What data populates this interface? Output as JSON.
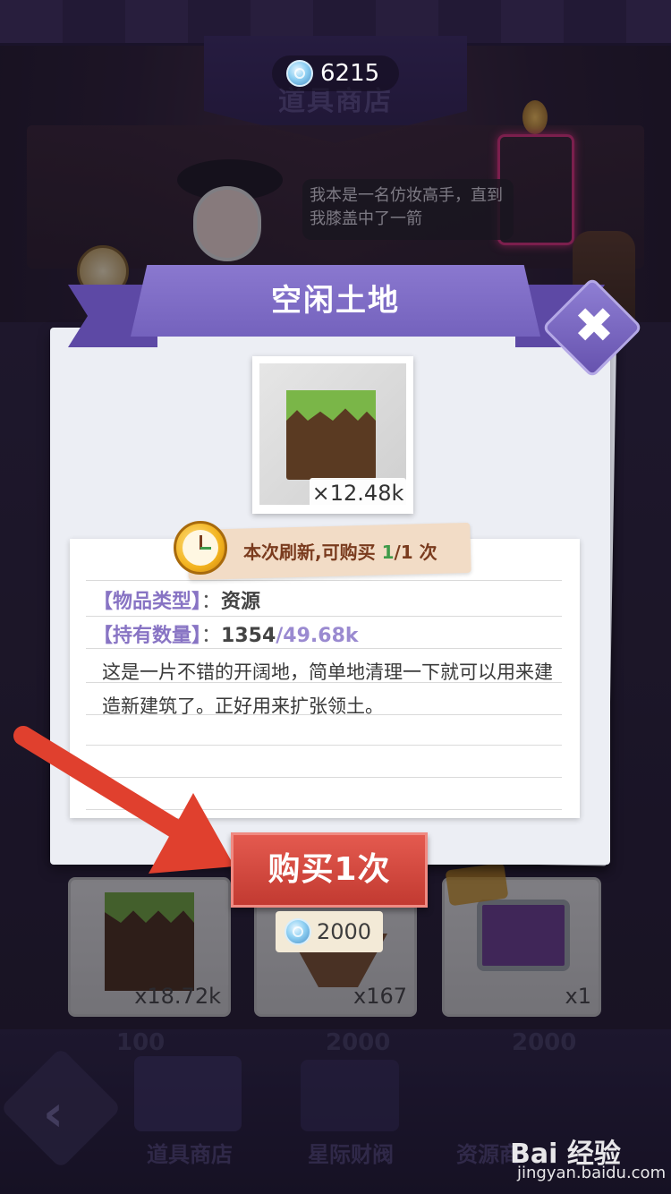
{
  "header": {
    "currency_value": "6215",
    "shop_sign": "道具商店"
  },
  "npc": {
    "speech": "我本是一名仿妆高手，直到我膝盖中了一箭"
  },
  "dialog": {
    "title": "空闲土地",
    "item_count": "×12.48k",
    "refresh": {
      "prefix": "本次刷新,可购买 ",
      "bought": "1",
      "suffix": "/1 次"
    },
    "rows": {
      "type_label": "【物品类型】",
      "type_sep": "：",
      "type_value": "资源",
      "own_label": "【持有数量】",
      "own_sep": "：",
      "own_value": "1354",
      "own_max": "/49.68k"
    },
    "description": "这是一片不错的开阔地，简单地清理一下就可以用来建造新建筑了。正好用来扩张领土。",
    "buy_button": "购买1次",
    "price": "2000"
  },
  "background_cards": [
    {
      "count": "x18.72k",
      "price": "100"
    },
    {
      "count": "x167",
      "price": "2000"
    },
    {
      "count": "x1",
      "price": "2000"
    }
  ],
  "nav": {
    "items": [
      "道具商店",
      "星际财阀",
      "资源商"
    ]
  },
  "watermark": {
    "brand": "Bai 经验",
    "url": "jingyan.baidu.com"
  },
  "colors": {
    "ribbon": "#7462bd",
    "buy_button": "#c23a31",
    "annotation_arrow": "#e0402e"
  }
}
